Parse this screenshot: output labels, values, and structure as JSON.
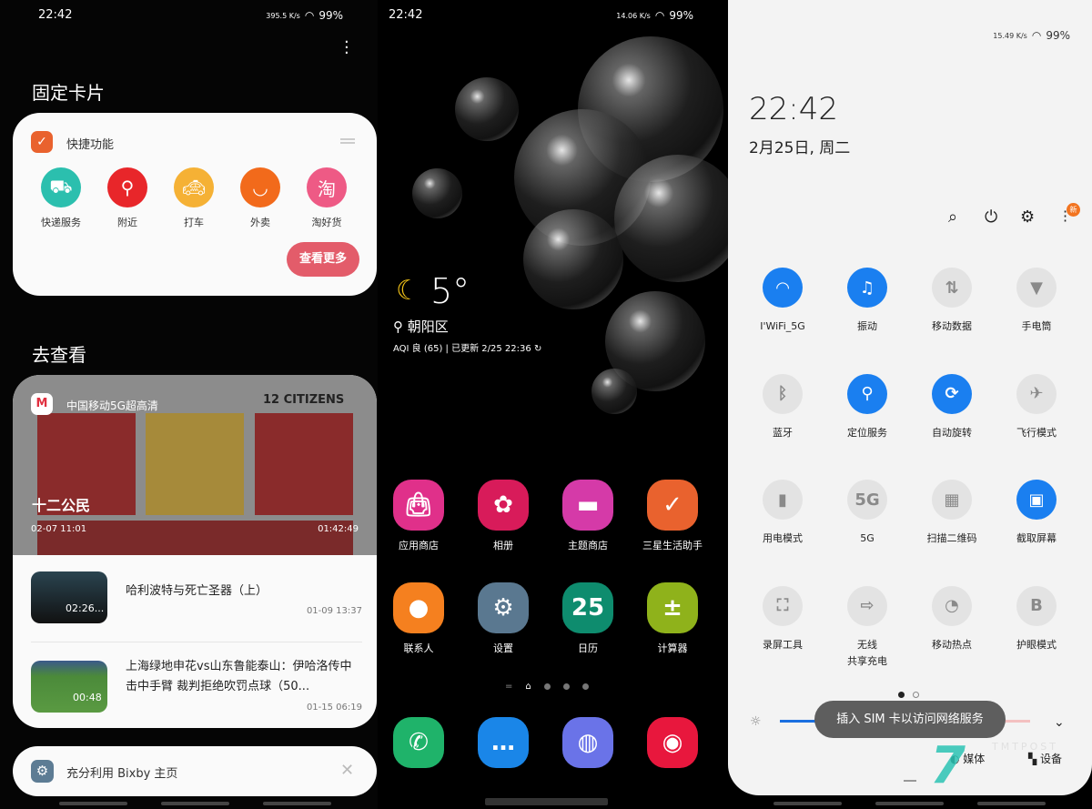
{
  "left": {
    "status": {
      "time": "22:42",
      "speed": "395.5 K/s",
      "battery": "99%"
    },
    "pinned_title": "固定卡片",
    "shortcuts_card": {
      "title": "快捷功能",
      "items": [
        {
          "label": "快递服务",
          "icon": "delivery-truck-icon",
          "color": "#2bbfae"
        },
        {
          "label": "附近",
          "icon": "location-pin-icon",
          "color": "#e8262a"
        },
        {
          "label": "打车",
          "icon": "taxi-icon",
          "color": "#f5b135"
        },
        {
          "label": "外卖",
          "icon": "food-bowl-icon",
          "color": "#f26a1b"
        },
        {
          "label": "淘好货",
          "icon": "taobao-search-icon",
          "color": "#ee5a85"
        }
      ],
      "more_button": "查看更多"
    },
    "browse_title": "去查看",
    "video_card": {
      "app_name": "中国移动5G超高清",
      "featured": {
        "title": "十二公民",
        "date": "02-07 11:01",
        "duration": "01:42:49",
        "poster_text": "12 CITIZENS"
      },
      "items": [
        {
          "title": "哈利波特与死亡圣器（上）",
          "duration": "02:26...",
          "date": "01-09 13:37"
        },
        {
          "title": "上海绿地申花vs山东鲁能泰山：伊哈洛传中击中手臂 裁判拒绝吹罚点球（50...",
          "duration": "00:48",
          "date": "01-15 06:19"
        }
      ]
    },
    "bixby_tip": "充分利用 Bixby 主页"
  },
  "middle": {
    "status": {
      "time": "22:42",
      "speed": "14.06 K/s",
      "battery": "99%"
    },
    "weather": {
      "temp": "5°",
      "location": "朝阳区",
      "aqi": "AQI 良 (65)",
      "updated": "已更新 2/25 22:36"
    },
    "apps": [
      {
        "label": "应用商店",
        "icon": "shopping-bag-icon",
        "color": "#e0308a"
      },
      {
        "label": "相册",
        "icon": "flower-icon",
        "color": "#d81b5a"
      },
      {
        "label": "主题商店",
        "icon": "paint-brush-icon",
        "color": "#d53aa8"
      },
      {
        "label": "三星生活助手",
        "icon": "check-exclaim-icon",
        "color": "#e9622e"
      },
      {
        "label": "联系人",
        "icon": "person-icon",
        "color": "#f5801f"
      },
      {
        "label": "设置",
        "icon": "gear-icon",
        "color": "#5a7890"
      },
      {
        "label": "日历",
        "icon": "calendar-icon",
        "color": "#0e8c6e",
        "glyph": "25"
      },
      {
        "label": "计算器",
        "icon": "calculator-icon",
        "color": "#8fb21b"
      }
    ],
    "dock": [
      {
        "icon": "phone-icon",
        "color": "#1fb36a"
      },
      {
        "icon": "message-icon",
        "color": "#1a86e8"
      },
      {
        "icon": "browser-planet-icon",
        "color": "#6a73e8"
      },
      {
        "icon": "camera-icon",
        "color": "#e8173d"
      }
    ]
  },
  "right": {
    "status": {
      "speed": "15.49 K/s",
      "battery": "99%"
    },
    "clock": "22:42",
    "date": "2月25日, 周二",
    "new_badge": "新",
    "tiles": [
      {
        "label": "I'WiFi_5G",
        "icon": "wifi-icon",
        "on": true
      },
      {
        "label": "振动",
        "icon": "vibrate-icon",
        "on": true
      },
      {
        "label": "移动数据",
        "icon": "data-arrows-icon",
        "on": false
      },
      {
        "label": "手电筒",
        "icon": "flashlight-icon",
        "on": false
      },
      {
        "label": "蓝牙",
        "icon": "bluetooth-icon",
        "on": false
      },
      {
        "label": "定位服务",
        "icon": "location-icon",
        "on": true
      },
      {
        "label": "自动旋转",
        "icon": "rotate-icon",
        "on": true
      },
      {
        "label": "飞行模式",
        "icon": "airplane-icon",
        "on": false
      },
      {
        "label": "用电模式",
        "icon": "battery-saver-icon",
        "on": false
      },
      {
        "label": "5G",
        "icon": "5g-icon",
        "on": false,
        "glyph": "5G"
      },
      {
        "label": "扫描二维码",
        "icon": "qr-code-icon",
        "on": false
      },
      {
        "label": "截取屏幕",
        "icon": "screenshot-icon",
        "on": true
      },
      {
        "label": "录屏工具",
        "icon": "screen-record-icon",
        "on": false
      },
      {
        "label": "无线\n共享充电",
        "icon": "wireless-share-icon",
        "on": false
      },
      {
        "label": "移动热点",
        "icon": "hotspot-icon",
        "on": false
      },
      {
        "label": "护眼模式",
        "icon": "eye-comfort-icon",
        "on": false,
        "glyph": "B"
      }
    ],
    "brightness": 0.3,
    "toast": "插入 SIM 卡以访问网络服务",
    "media_label": "媒体",
    "devices_label": "设备",
    "watermark": "TMTPOST 钛媒体"
  },
  "accent": "#1a7ff0"
}
